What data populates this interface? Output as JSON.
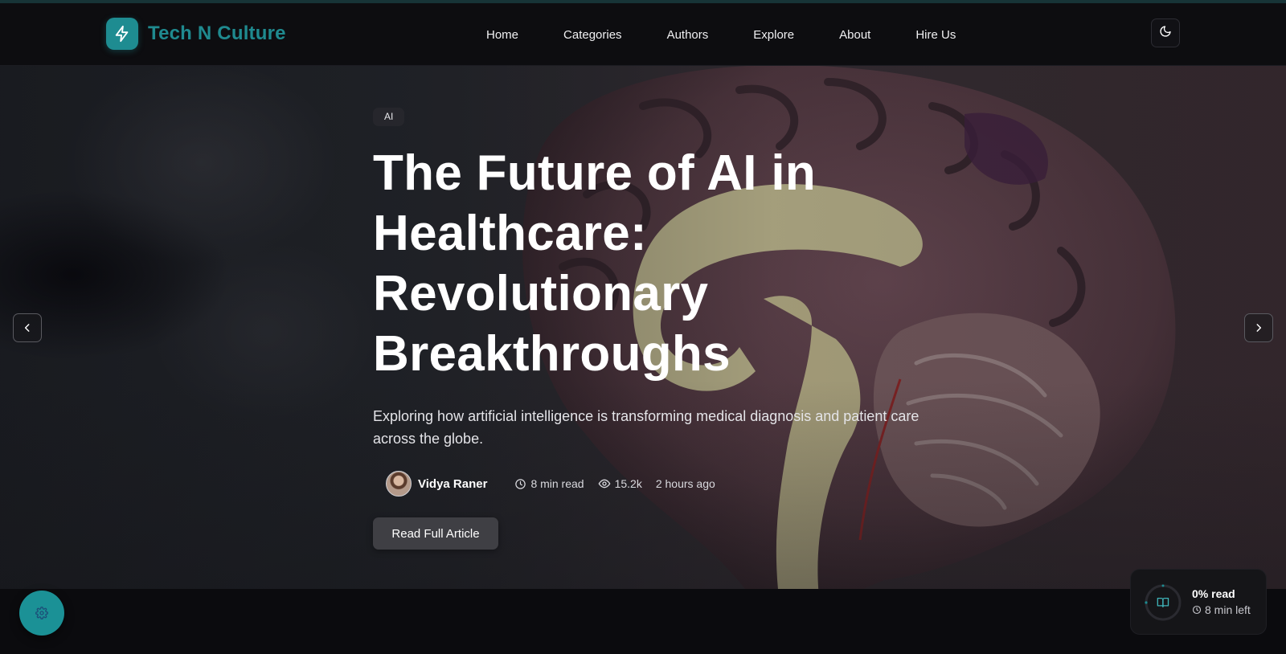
{
  "brand": {
    "name": "Tech N Culture",
    "logo_icon": "lightning-icon",
    "accent": "#1e8c91"
  },
  "nav": {
    "items": [
      {
        "label": "Home"
      },
      {
        "label": "Categories"
      },
      {
        "label": "Authors"
      },
      {
        "label": "Explore"
      },
      {
        "label": "About"
      },
      {
        "label": "Hire Us"
      }
    ],
    "theme_toggle_icon": "moon-icon"
  },
  "hero": {
    "category": "AI",
    "title": "The Future of AI in Healthcare: Revolutionary Breakthroughs",
    "subtitle": "Exploring how artificial intelligence is transforming medical diagnosis and patient care across the globe.",
    "author": "Vidya Raner",
    "read_time": "8 min read",
    "views": "15.2k",
    "posted": "2 hours ago",
    "cta_label": "Read Full Article",
    "prev_icon": "chevron-left-icon",
    "next_icon": "chevron-right-icon"
  },
  "reading_progress": {
    "percent_label": "0% read",
    "time_left": "8 min left",
    "progress_fraction": 0,
    "icon": "book-open-icon"
  },
  "settings": {
    "icon": "gear-icon"
  }
}
